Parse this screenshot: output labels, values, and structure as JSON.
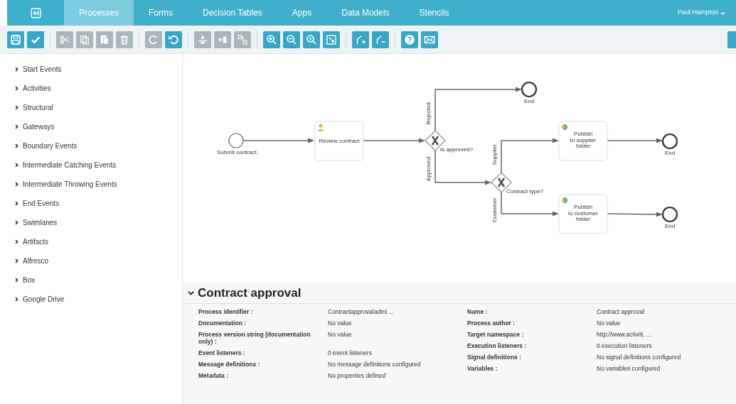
{
  "navbar": {
    "tabs": [
      {
        "label": "Processes",
        "selected": true
      },
      {
        "label": "Forms",
        "selected": false
      },
      {
        "label": "Decision Tables",
        "selected": false
      },
      {
        "label": "Apps",
        "selected": false
      },
      {
        "label": "Data Models",
        "selected": false
      },
      {
        "label": "Stencils",
        "selected": false
      }
    ],
    "user": "Paul Hampton"
  },
  "toolbar": {
    "groups": [
      [
        {
          "kind": "save",
          "disabled": false
        },
        {
          "kind": "check",
          "disabled": false
        }
      ],
      [
        {
          "kind": "cut",
          "disabled": true
        },
        {
          "kind": "copy",
          "disabled": true
        },
        {
          "kind": "paste",
          "disabled": true
        },
        {
          "kind": "delete",
          "disabled": true
        }
      ],
      [
        {
          "kind": "redo",
          "disabled": true
        },
        {
          "kind": "undo",
          "disabled": false
        }
      ],
      [
        {
          "kind": "align",
          "disabled": true
        },
        {
          "kind": "morph",
          "disabled": true
        },
        {
          "kind": "connect",
          "disabled": true
        }
      ],
      [
        {
          "kind": "zoom-in",
          "disabled": false
        },
        {
          "kind": "zoom-out",
          "disabled": false
        },
        {
          "kind": "zoom-actual",
          "disabled": false
        },
        {
          "kind": "zoom-fit",
          "disabled": false
        }
      ],
      [
        {
          "kind": "bend-add",
          "disabled": false
        },
        {
          "kind": "bend-remove",
          "disabled": false
        }
      ],
      [
        {
          "kind": "help",
          "disabled": false
        },
        {
          "kind": "feedback",
          "disabled": false
        }
      ]
    ]
  },
  "palette": [
    {
      "label": "Start Events",
      "expanded": false
    },
    {
      "label": "Activities",
      "expanded": false
    },
    {
      "label": "Structural",
      "expanded": false
    },
    {
      "label": "Gateways",
      "expanded": false
    },
    {
      "label": "Boundary Events",
      "expanded": false
    },
    {
      "label": "Intermediate Catching Events",
      "expanded": false
    },
    {
      "label": "Intermediate Throwing Events",
      "expanded": false
    },
    {
      "label": "End Events",
      "expanded": false
    },
    {
      "label": "Swimlanes",
      "expanded": false
    },
    {
      "label": "Artifacts",
      "expanded": false
    },
    {
      "label": "Alfresco",
      "expanded": false
    },
    {
      "label": "Box",
      "expanded": false
    },
    {
      "label": "Google Drive",
      "expanded": false
    }
  ],
  "diagram": {
    "nodes": [
      {
        "kind": "start",
        "lines": [
          "Submit contract."
        ]
      },
      {
        "kind": "user-task",
        "lines": [
          "Review contract"
        ]
      },
      {
        "kind": "gateway",
        "lines": [
          "Is approved?"
        ]
      },
      {
        "kind": "end",
        "lines": [
          "End"
        ]
      },
      {
        "kind": "gateway",
        "lines": [
          "Contract type?"
        ]
      },
      {
        "kind": "service-task",
        "lines": [
          "Publish",
          "to supplier",
          "folder"
        ]
      },
      {
        "kind": "end",
        "lines": [
          "End"
        ]
      },
      {
        "kind": "service-task",
        "lines": [
          "Publish",
          "to customer",
          "folder"
        ]
      },
      {
        "kind": "end",
        "lines": [
          "End"
        ]
      }
    ],
    "flow_labels": [
      "Rejected",
      "Approved",
      "Supplier",
      "Customer"
    ]
  },
  "properties": {
    "title": "Contract approval",
    "expanded": true,
    "left": [
      {
        "label": "Process identifier :",
        "value": "Contractapprovaladmi ..."
      },
      {
        "label": "Documentation :",
        "value": "No value"
      },
      {
        "label": "Process version string (documentation only) :",
        "value": "No value"
      },
      {
        "label": "Event listeners :",
        "value": "0 event listeners"
      },
      {
        "label": "Message definitions :",
        "value": "No message definitions configured"
      },
      {
        "label": "Metadata :",
        "value": "No properties defined"
      }
    ],
    "right": [
      {
        "label": "Name :",
        "value": "Contract approval"
      },
      {
        "label": "Process author :",
        "value": "No value"
      },
      {
        "label": "Target namespace :",
        "value": "http://www.activiti. ..."
      },
      {
        "label": "Execution listeners :",
        "value": "0 execution listeners"
      },
      {
        "label": "Signal definitions :",
        "value": "No signal definitions configured"
      },
      {
        "label": "Variables :",
        "value": "No variables configured"
      }
    ]
  }
}
